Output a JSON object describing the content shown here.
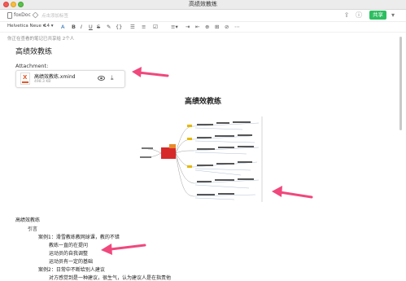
{
  "window": {
    "title": "高绩效教练"
  },
  "toolbar": {
    "notebook": "foxDoc",
    "tag_placeholder": "点击添加标签",
    "share_label": "共享",
    "font_family": "Helvetica Neue",
    "font_size": "14",
    "format_buttons": [
      "A",
      "B",
      "I",
      "U",
      "S",
      "☰",
      "{}"
    ]
  },
  "note": {
    "shared_info": "你正在查看的笔记已共享给 2个人",
    "title": "高绩效教练",
    "attachment_label": "Attachment:",
    "attachment": {
      "name": "高绩效教练.xmind",
      "size": "498.3 KB"
    }
  },
  "mindmap": {
    "title": "高绩效教练"
  },
  "outline": {
    "root": "高绩效教练",
    "intro": "引言",
    "lines": [
      "案例1：滑雪教练教网球课，教的不错",
      "教练一直的在提问",
      "运动员的自我调整",
      "运动员有一定的基础",
      "案例2：日常中不断给别人建议",
      "对方感觉到是一种建议，很生气，认为建议人是在指责他"
    ]
  },
  "colors": {
    "accent": "#2dbe60",
    "annotation_arrow": "#f0487d",
    "mindmap_center": "#d62a2a"
  }
}
